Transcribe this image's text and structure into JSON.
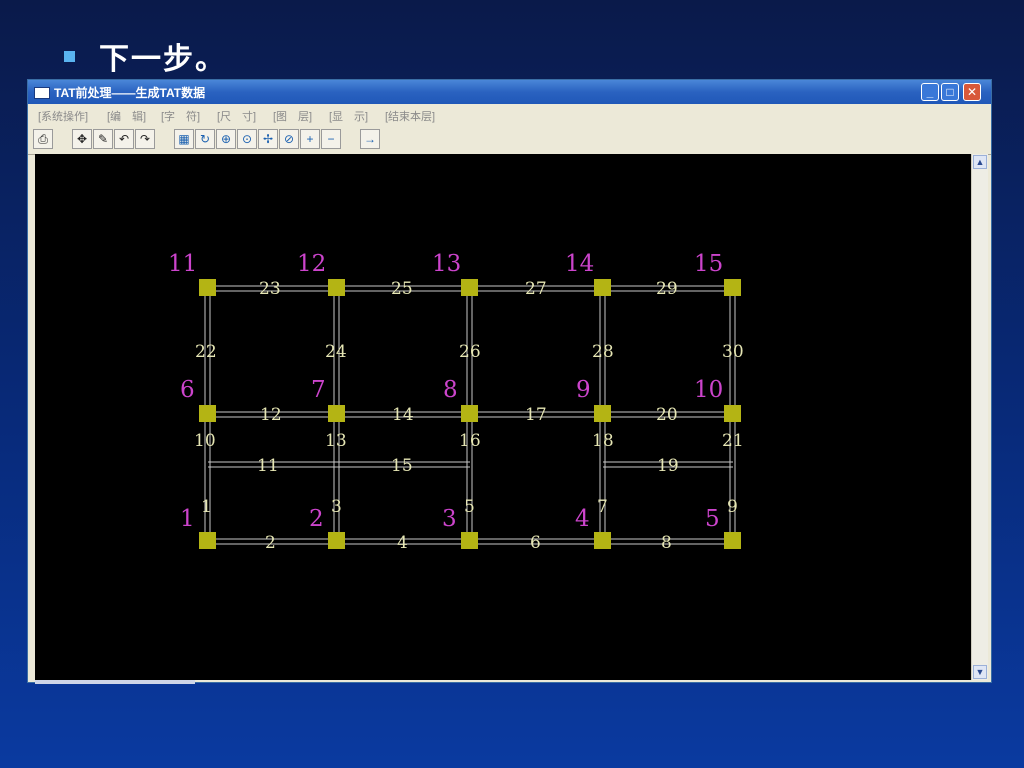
{
  "slide": {
    "heading": "下一步。"
  },
  "window": {
    "title": "TAT前处理——生成TAT数据",
    "controls": {
      "minimize": "_",
      "maximize": "□",
      "close": "✕"
    }
  },
  "menu": {
    "items": [
      "[系统操作]",
      "[编　辑]",
      "[字　符]",
      "[尺　寸]",
      "[图　层]",
      "[显　示]",
      "[结束本层]"
    ]
  },
  "toolbar": {
    "icons": [
      "print-icon",
      "move-icon",
      "edit-icon",
      "undo-icon",
      "redo-icon",
      "zoom-fit-icon",
      "refresh-icon",
      "zoom-window-icon",
      "zoom-dynamic-icon",
      "pan-icon",
      "zoom-previous-icon",
      "zoom-in-icon",
      "zoom-out-icon",
      "next-arrow-icon"
    ]
  },
  "diagram": {
    "colors": {
      "node": "#b4b414",
      "node_label": "#cc44cc",
      "member_label": "#e6e6b4",
      "member_line": "#c8c8c8"
    },
    "node_labels": [
      "11",
      "12",
      "13",
      "14",
      "15",
      "6",
      "7",
      "8",
      "9",
      "10",
      "1",
      "2",
      "3",
      "4",
      "5"
    ],
    "member_labels": [
      "23",
      "25",
      "27",
      "29",
      "22",
      "24",
      "26",
      "28",
      "30",
      "12",
      "14",
      "17",
      "20",
      "10",
      "13",
      "16",
      "18",
      "21",
      "11",
      "15",
      "19",
      "1",
      "3",
      "5",
      "7",
      "9",
      "2",
      "4",
      "6",
      "8"
    ]
  }
}
